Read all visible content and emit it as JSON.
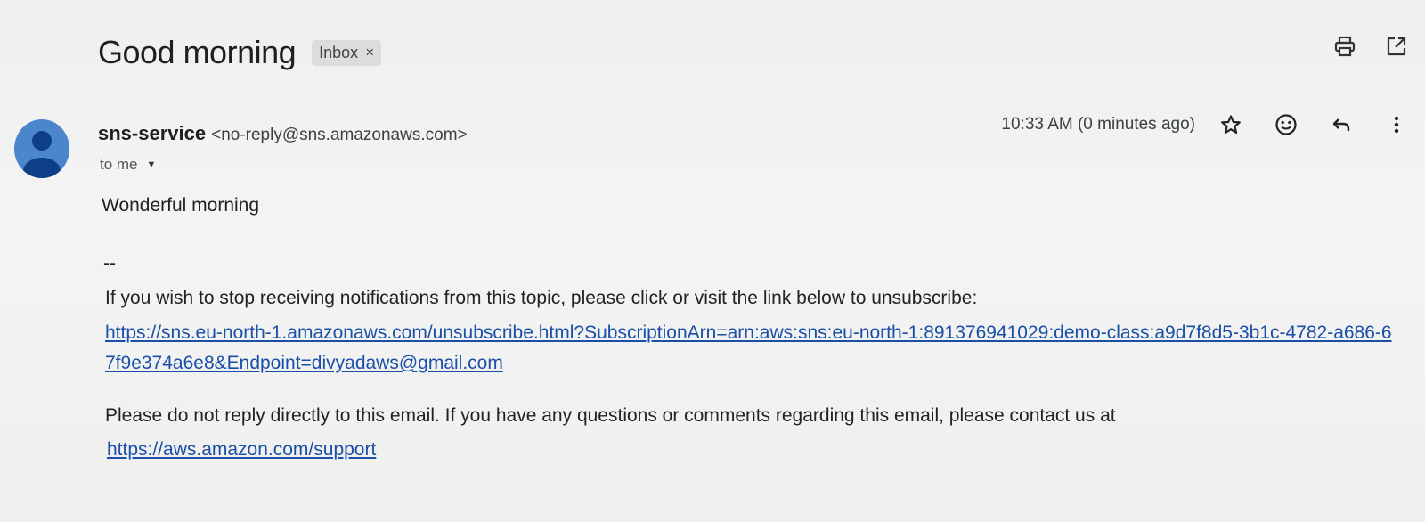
{
  "email": {
    "subject": "Good morning",
    "label_chip": {
      "text": "Inbox",
      "close_glyph": "×"
    },
    "sender": {
      "name": "sns-service",
      "address": "<no-reply@sns.amazonaws.com>"
    },
    "recipient_text": "to me",
    "timestamp": "10:33 AM (0 minutes ago)",
    "body": {
      "greeting": "Wonderful morning",
      "signature_marker": "--",
      "unsubscribe_text": "If you wish to stop receiving notifications from this topic, please click or visit the link below to unsubscribe:",
      "unsubscribe_link": "https://sns.eu-north-1.amazonaws.com/unsubscribe.html?SubscriptionArn=arn:aws:sns:eu-north-1:891376941029:demo-class:a9d7f8d5-3b1c-4782-a686-67f9e374a6e8&Endpoint=divyadaws@gmail.com",
      "contact_text": "Please do not reply directly to this email. If you have any questions or comments regarding this email, please contact us at",
      "support_link": "https://aws.amazon.com/support"
    }
  },
  "icons": {
    "top": [
      "print-icon",
      "open-in-new-window-icon"
    ],
    "meta": [
      "star-icon",
      "emoji-reaction-icon",
      "reply-icon",
      "more-options-icon"
    ]
  },
  "colors": {
    "avatar": "#4b86cc",
    "link": "#1a4fa8",
    "chip_background": "#dcdcdc"
  }
}
